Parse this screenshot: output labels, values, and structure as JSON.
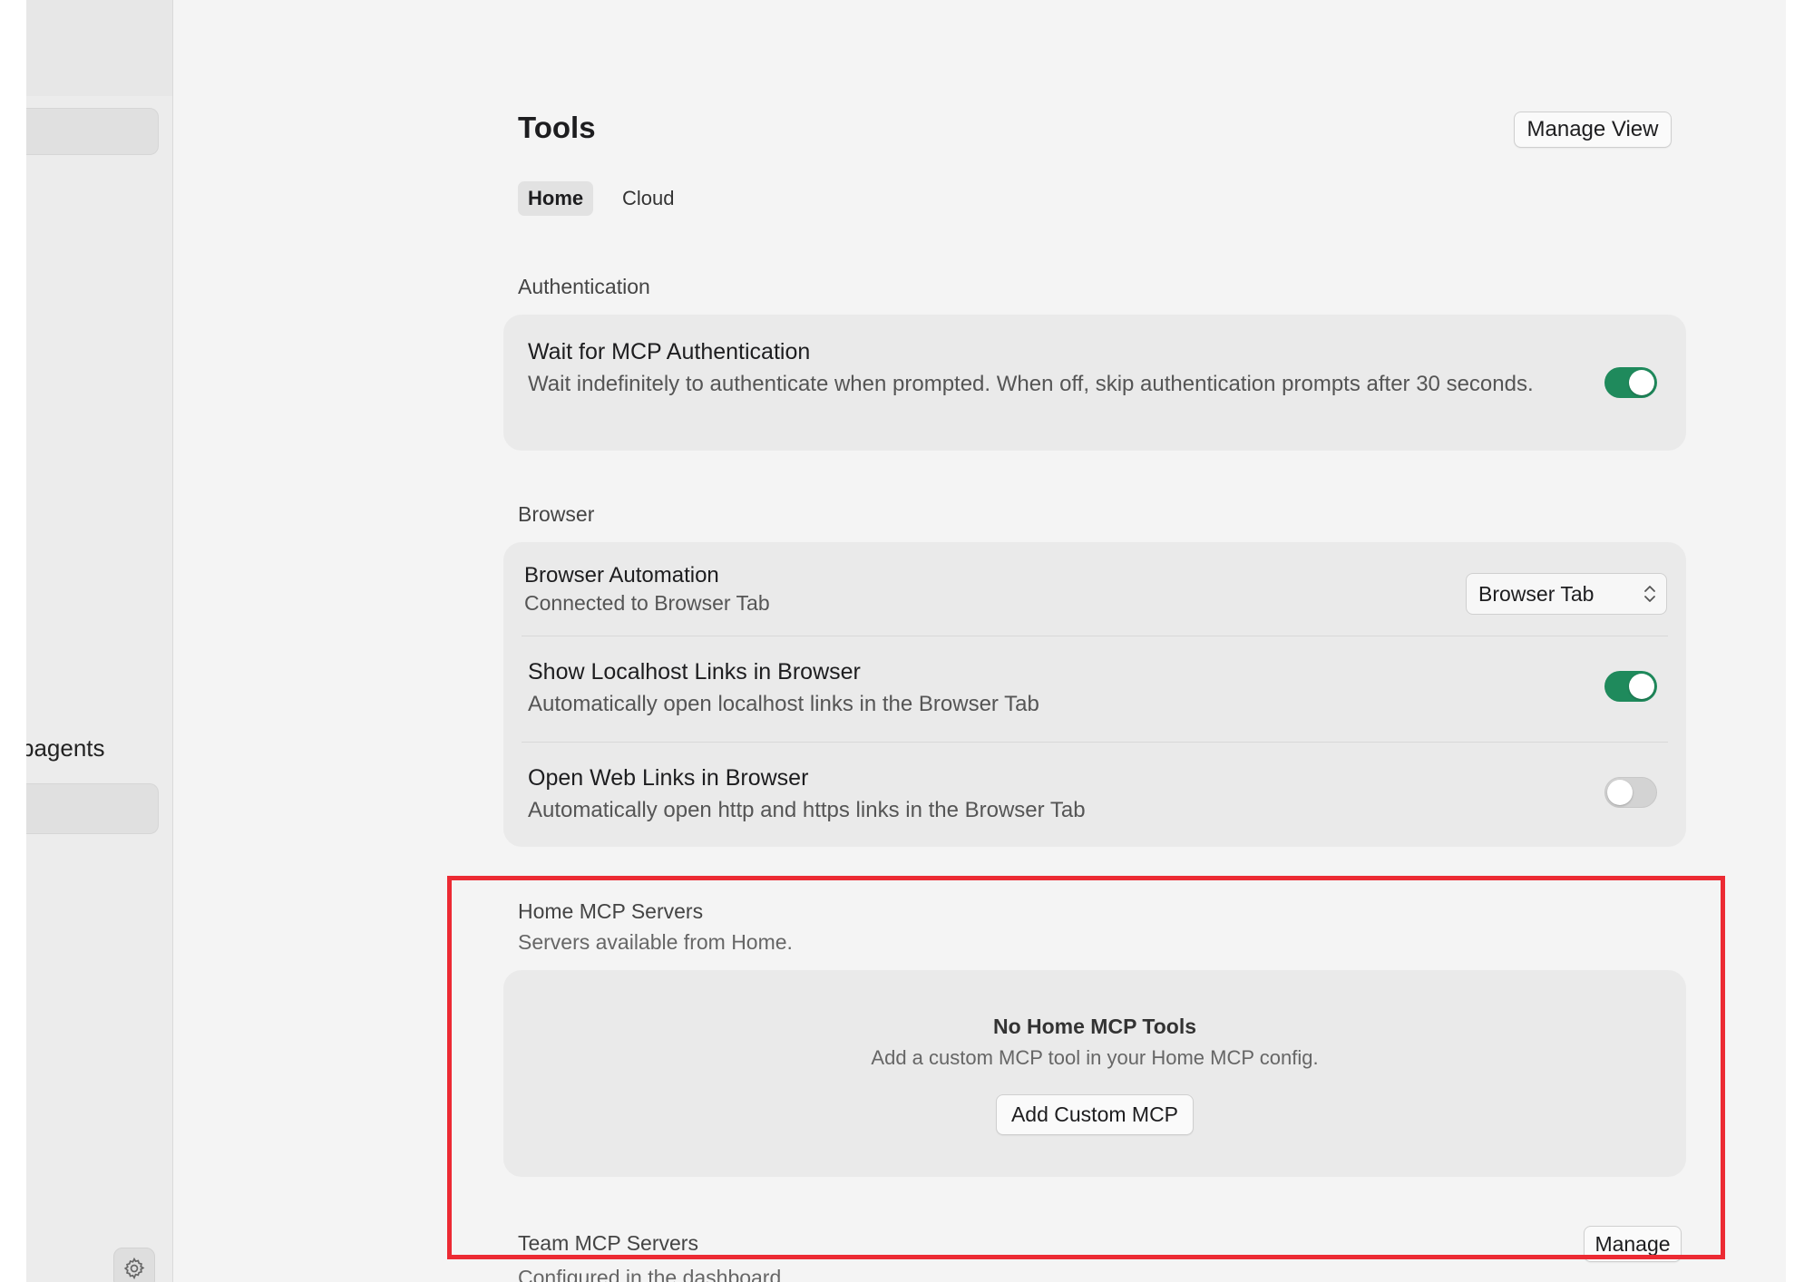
{
  "sidebar": {
    "partial_label": "bagents",
    "settings_icon": "gear-icon"
  },
  "page": {
    "title": "Tools",
    "manage_view_label": "Manage View"
  },
  "tabs": [
    {
      "label": "Home",
      "active": true
    },
    {
      "label": "Cloud",
      "active": false
    }
  ],
  "authentication": {
    "section_label": "Authentication",
    "wait_for_mcp": {
      "title": "Wait for MCP Authentication",
      "description": "Wait indefinitely to authenticate when prompted. When off, skip authentication prompts after 30 seconds.",
      "enabled": true
    }
  },
  "browser": {
    "section_label": "Browser",
    "automation": {
      "title": "Browser Automation",
      "description": "Connected to Browser Tab",
      "select_value": "Browser Tab"
    },
    "localhost_links": {
      "title": "Show Localhost Links in Browser",
      "description": "Automatically open localhost links in the Browser Tab",
      "enabled": true
    },
    "web_links": {
      "title": "Open Web Links in Browser",
      "description": "Automatically open http and https links in the Browser Tab",
      "enabled": false
    }
  },
  "home_mcp": {
    "section_label": "Home MCP Servers",
    "section_sub": "Servers available from Home.",
    "empty_title": "No Home MCP Tools",
    "empty_desc": "Add a custom MCP tool in your Home MCP config.",
    "add_button_label": "Add Custom MCP"
  },
  "team_mcp": {
    "section_label": "Team MCP Servers",
    "section_sub": "Configured in the dashboard",
    "manage_label": "Manage"
  },
  "colors": {
    "toggle_on": "#1f8a5c",
    "highlight": "#ec2a33"
  }
}
